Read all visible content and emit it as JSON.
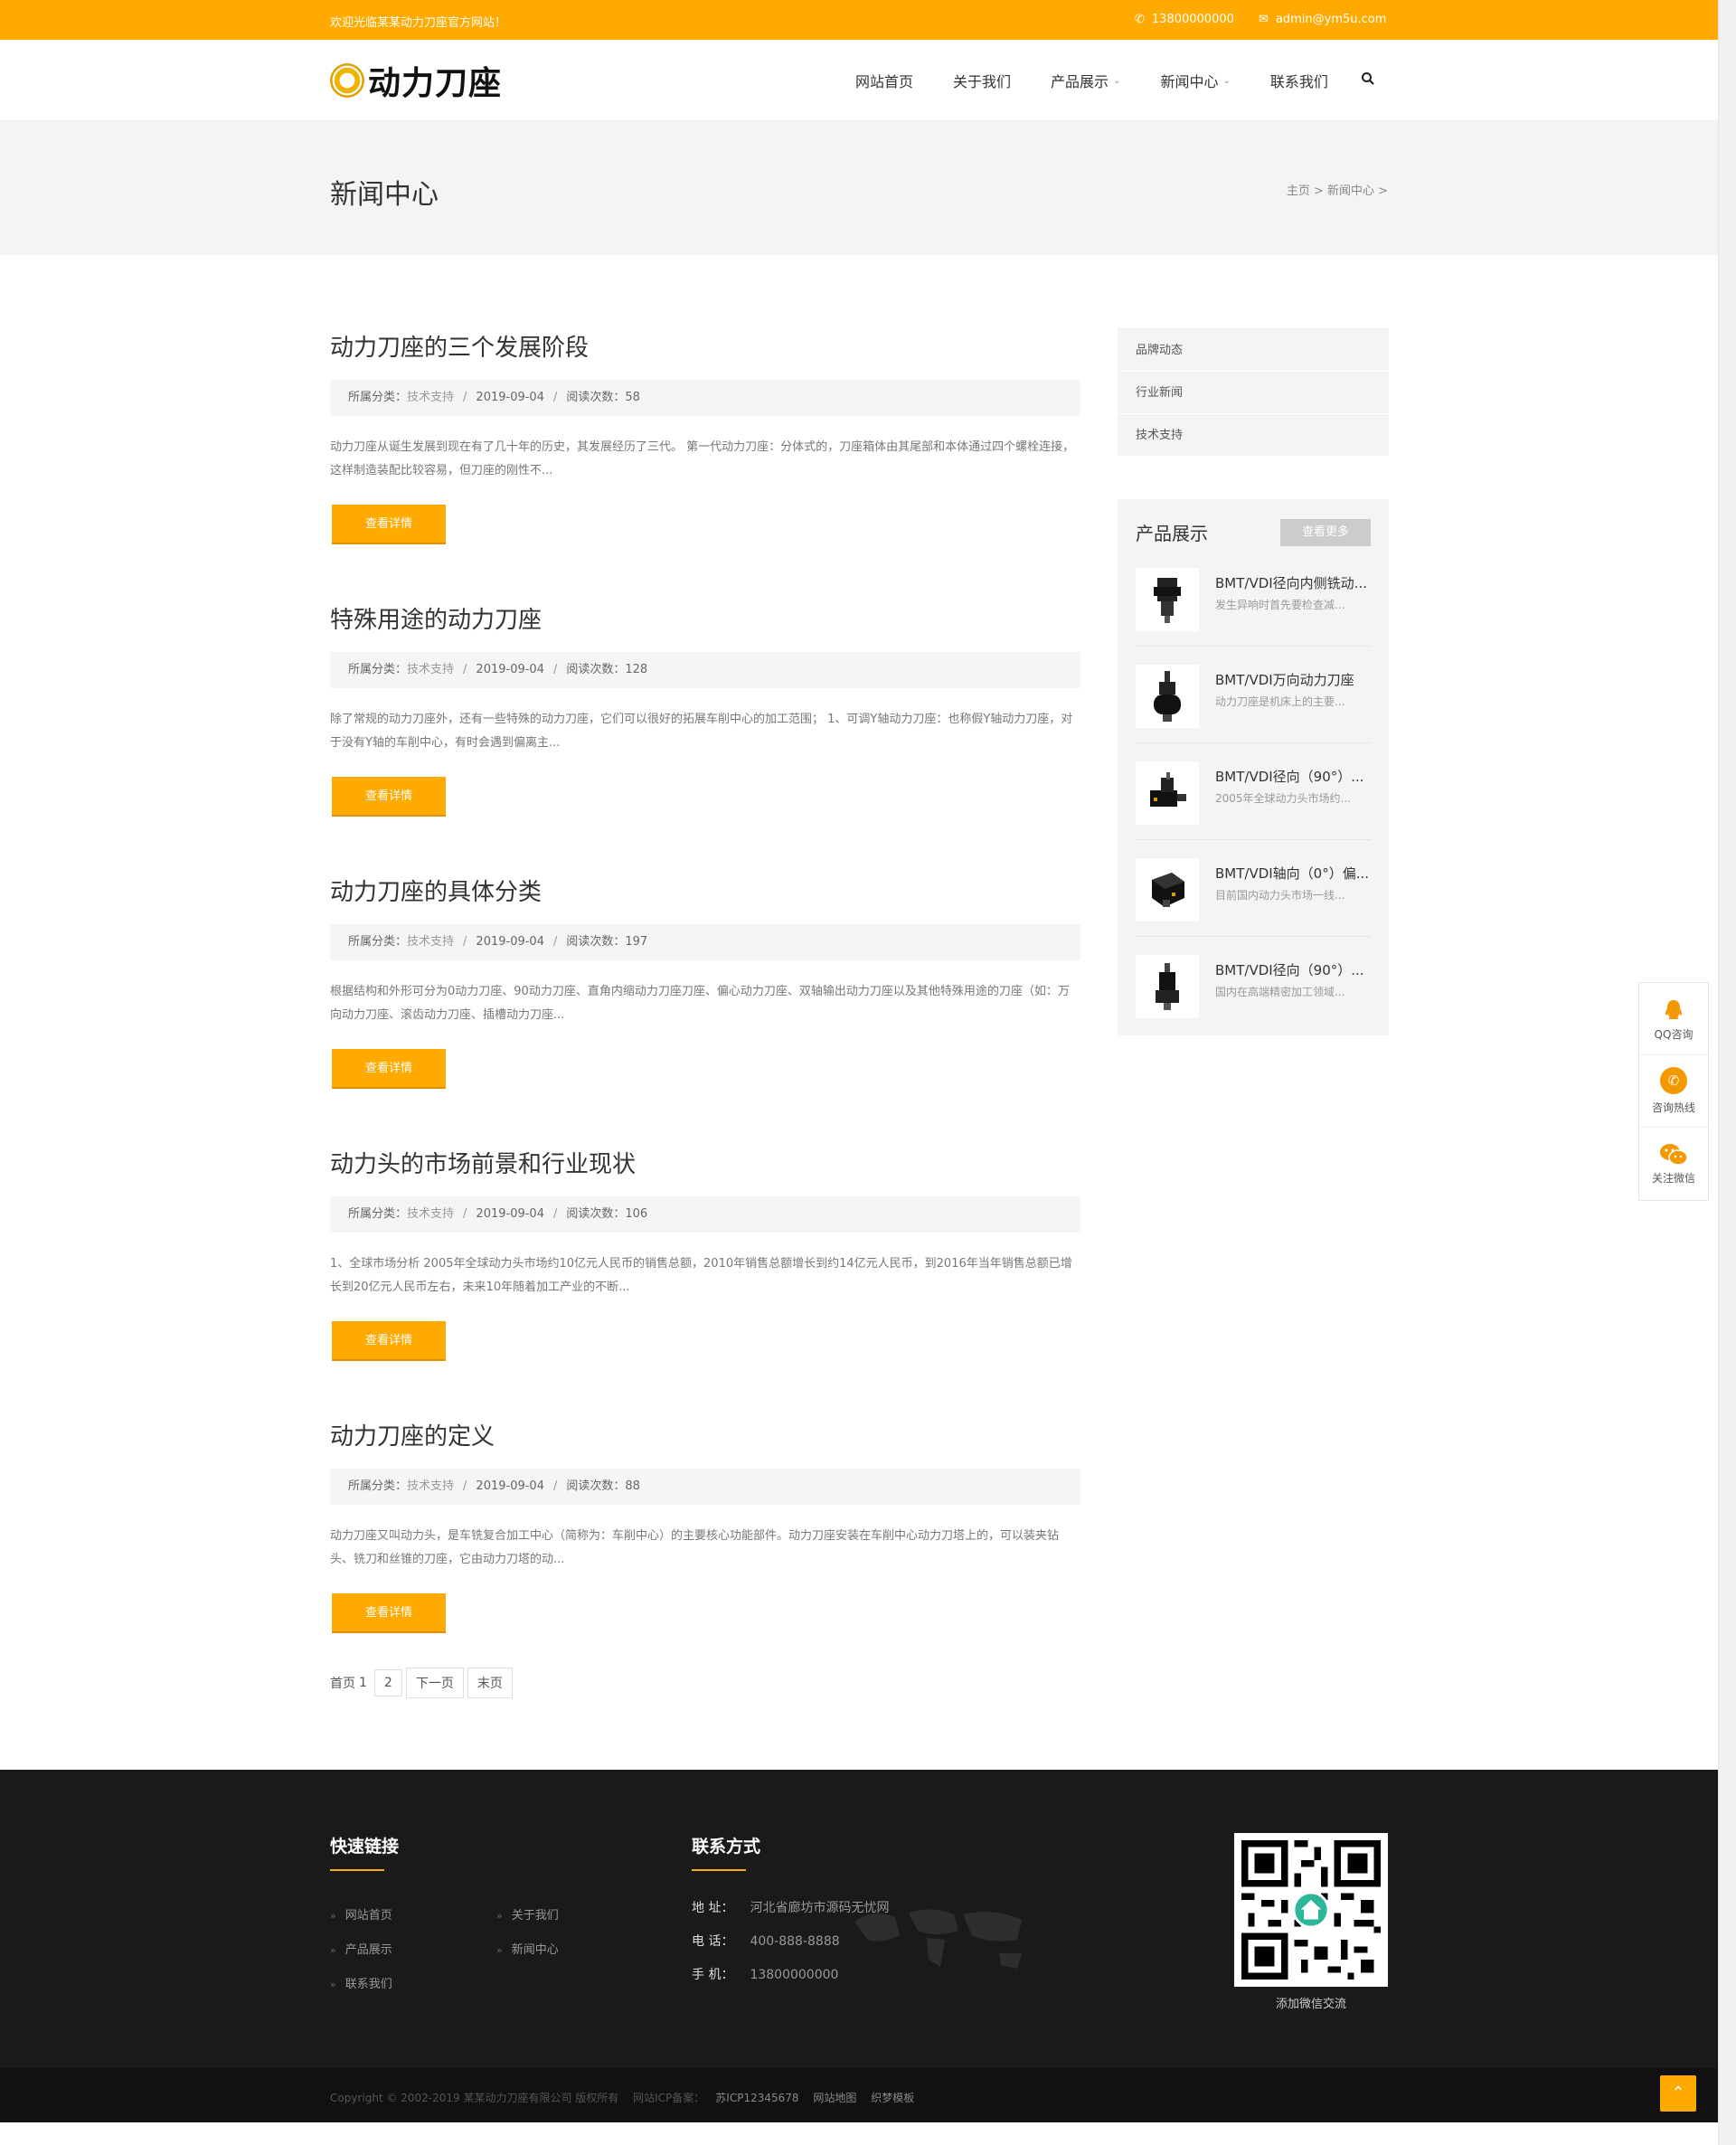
{
  "topbar": {
    "welcome": "欢迎光临某某动力刀座官方网站！",
    "phone": "13800000000",
    "email": "admin@ym5u.com"
  },
  "header": {
    "logo_text": "动力刀座",
    "nav": [
      "网站首页",
      "关于我们",
      "产品展示",
      "新闻中心",
      "联系我们"
    ]
  },
  "banner": {
    "title": "新闻中心",
    "breadcrumb": "主页 > 新闻中心 >"
  },
  "posts": [
    {
      "title": "动力刀座的三个发展阶段",
      "category_label": "所属分类：",
      "category": "技术支持",
      "date": "2019-09-04",
      "views_label": "阅读次数：",
      "views": "58",
      "desc": "动力刀座从诞生发展到现在有了几十年的历史，其发展经历了三代。 第一代动力刀座：分体式的，刀座箱体由其尾部和本体通过四个螺栓连接，这样制造装配比较容易，但刀座的刚性不...",
      "button": "查看详情"
    },
    {
      "title": "特殊用途的动力刀座",
      "category_label": "所属分类：",
      "category": "技术支持",
      "date": "2019-09-04",
      "views_label": "阅读次数：",
      "views": "128",
      "desc": "除了常规的动力刀座外，还有一些特殊的动力刀座，它们可以很好的拓展车削中心的加工范围； 1、可调Y轴动力刀座：也称假Y轴动力刀座，对于没有Y轴的车削中心，有时会遇到偏离主...",
      "button": "查看详情"
    },
    {
      "title": "动力刀座的具体分类",
      "category_label": "所属分类：",
      "category": "技术支持",
      "date": "2019-09-04",
      "views_label": "阅读次数：",
      "views": "197",
      "desc": "根据结构和外形可分为0动力刀座、90动力刀座、直角内缩动力刀座刀座、偏心动力刀座、双轴输出动力刀座以及其他特殊用途的刀座（如：万向动力刀座、滚齿动力刀座、插槽动力刀座...",
      "button": "查看详情"
    },
    {
      "title": "动力头的市场前景和行业现状",
      "category_label": "所属分类：",
      "category": "技术支持",
      "date": "2019-09-04",
      "views_label": "阅读次数：",
      "views": "106",
      "desc": "1、全球市场分析 2005年全球动力头市场约10亿元人民币的销售总额，2010年销售总额增长到约14亿元人民币，到2016年当年销售总额已增长到20亿元人民币左右，未来10年随着加工产业的不断...",
      "button": "查看详情"
    },
    {
      "title": "动力刀座的定义",
      "category_label": "所属分类：",
      "category": "技术支持",
      "date": "2019-09-04",
      "views_label": "阅读次数：",
      "views": "88",
      "desc": "动力刀座又叫动力头，是车铣复合加工中心（简称为：车削中心）的主要核心功能部件。动力刀座安装在车削中心动力刀塔上的，可以装夹钻头、铣刀和丝锥的刀座，它由动力刀塔的动...",
      "button": "查看详情"
    }
  ],
  "pagination": {
    "first": "首页",
    "current": "1",
    "page2": "2",
    "next": "下一页",
    "last": "末页"
  },
  "sidebar": {
    "categories": [
      "品牌动态",
      "行业新闻",
      "技术支持"
    ],
    "products_title": "产品展示",
    "more_button": "查看更多",
    "products": [
      {
        "name": "BMT/VDI径向内侧铣动...",
        "desc": "发生异响时首先要检查减..."
      },
      {
        "name": "BMT/VDI万向动力刀座",
        "desc": "动力刀座是机床上的主要..."
      },
      {
        "name": "BMT/VDI径向（90°）...",
        "desc": "2005年全球动力头市场约..."
      },
      {
        "name": "BMT/VDI轴向（0°）偏...",
        "desc": "目前国内动力头市场一线..."
      },
      {
        "name": "BMT/VDI径向（90°）...",
        "desc": "国内在高端精密加工领域..."
      }
    ]
  },
  "float_tools": {
    "qq": "QQ咨询",
    "hotline": "咨询热线",
    "wechat": "关注微信"
  },
  "footer": {
    "links_title": "快速链接",
    "links": [
      "网站首页",
      "关于我们",
      "产品展示",
      "新闻中心",
      "联系我们"
    ],
    "contact_title": "联系方式",
    "address_label": "地 址：",
    "address": "河北省廊坊市源码无忧网",
    "tel_label": "电 话：",
    "tel": "400-888-8888",
    "mobile_label": "手 机：",
    "mobile": "13800000000",
    "qr_caption": "添加微信交流",
    "copyright": "Copyright © 2002-2019 某某动力刀座有限公司 版权所有",
    "icp_label": "网站ICP备案：",
    "icp": "苏ICP12345678",
    "sitemap": "网站地图",
    "template": "织梦模板"
  },
  "colors": {
    "accent": "#ffaa00",
    "footer_bg": "#1a1a1a"
  }
}
